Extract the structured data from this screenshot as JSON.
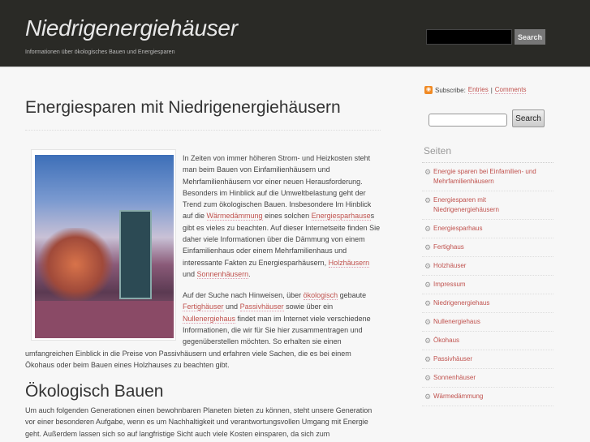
{
  "header": {
    "title": "Niedrigenergiehäuser",
    "description": "Informationen über ökologisches Bauen und Energiesparen",
    "search_label": "Search"
  },
  "post": {
    "title": "Energiesparen mit Niedrigenergiehäusern",
    "paragraphs": [
      [
        {
          "t": "In Zeiten von immer höheren Strom- und Heizkosten steht man beim Bauen von Einfamilienhäusern und Mehrfamilienhäusern vor einer neuen Herausforderung. Besonders im Hinblick auf die Umweltbelastung geht der Trend zum ökologischen Bauen. Insbesondere Im Hinblick auf die "
        },
        {
          "t": "Wärmedämmung",
          "link": true
        },
        {
          "t": " eines solchen "
        },
        {
          "t": "Energiesparhause",
          "link": true
        },
        {
          "t": "s gibt es vieles zu beachten. Auf dieser Internetseite finden Sie daher viele Informationen über die Dämmung von einem Einfamilienhaus oder einem Mehrfamilienhaus und interessante Fakten zu Energiesparhäusern, "
        },
        {
          "t": "Holzhäusern",
          "link": true
        },
        {
          "t": " und "
        },
        {
          "t": "Sonnenhäusern",
          "link": true
        },
        {
          "t": "."
        }
      ],
      [
        {
          "t": "Auf der Suche nach Hinweisen, über "
        },
        {
          "t": "ökologisch",
          "link": true
        },
        {
          "t": " gebaute "
        },
        {
          "t": "Fertighäuser",
          "link": true
        },
        {
          "t": " und "
        },
        {
          "t": "Passivhäuser",
          "link": true
        },
        {
          "t": " sowie über ein "
        },
        {
          "t": "Nullenergiehaus",
          "link": true
        },
        {
          "t": " findet man im Internet viele verschiedene Informationen, die wir für Sie hier zusammentragen und gegenüberstellen möchten. So erhalten sie einen"
        }
      ],
      [
        {
          "t": "umfangreichen Einblick in die Preise von Passivhäusern und erfahren viele Sachen, die es bei einem Ökohaus oder beim Bauen eines Holzhauses zu beachten gibt."
        }
      ],
      [
        {
          "t": "Um auch folgenden Generationen einen bewohnbaren Planeten bieten zu können, steht unsere Generation vor einer besonderen Aufgabe, wenn es um Nachhaltigkeit und verantwortungsvollen Umgang mit Energie geht. Außerdem lassen sich so auf langfristige Sicht auch viele Kosten einsparen, da sich zum"
        }
      ]
    ],
    "subheading": "Ökologisch Bauen"
  },
  "sidebar": {
    "subscribe_label": "Subscribe:",
    "entries": "Entries",
    "separator": "|",
    "comments": "Comments",
    "search_label": "Search",
    "pages_title": "Seiten",
    "pages": [
      "Energie sparen bei Einfamilien- und Mehrfamilienhäusern",
      "Energiesparen mit Niedrigenergiehäusern",
      "Energiesparhaus",
      "Fertighaus",
      "Holzhäuser",
      "Impressum",
      "Niedrigenergiehaus",
      "Nullenergiehaus",
      "Ökohaus",
      "Passivhäuser",
      "Sonnenhäuser",
      "Wärmedämmung"
    ]
  }
}
